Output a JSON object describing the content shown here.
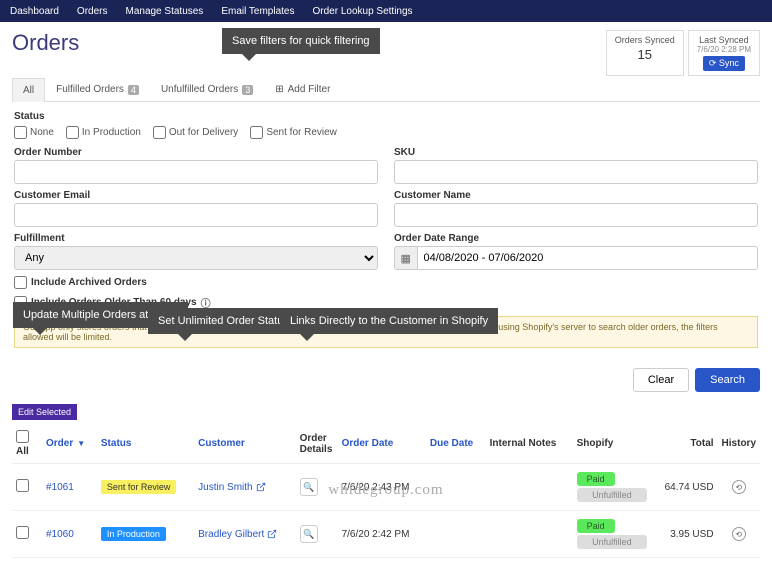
{
  "nav": [
    "Dashboard",
    "Orders",
    "Manage Statuses",
    "Email Templates",
    "Order Lookup Settings"
  ],
  "title": "Orders",
  "sync": {
    "orders_label": "Orders Synced",
    "orders_count": "15",
    "last_label": "Last Synced",
    "last_time": "7/6/20 2:28 PM",
    "btn": "⟳ Sync"
  },
  "tabs": {
    "all": "All",
    "fulfilled": "Fulfilled Orders",
    "fulfilled_badge": "4",
    "unfulfilled": "Unfulfilled Orders",
    "unfulfilled_badge": "3",
    "add": "Add Filter"
  },
  "filters": {
    "status_label": "Status",
    "statuses": [
      "None",
      "In Production",
      "Out for Delivery",
      "Sent for Review"
    ],
    "order_number": "Order Number",
    "sku": "SKU",
    "cust_email": "Customer Email",
    "cust_name": "Customer Name",
    "fulfillment": "Fulfillment",
    "fulfillment_val": "Any",
    "date_range": "Order Date Range",
    "date_val": "04/08/2020 - 07/06/2020",
    "archived": "Include Archived Orders",
    "older": "Include Orders Older Than 60 days",
    "info": "Our app only stores orders that were created within the last 60 days. To search older orders, check this. Because we're using Shopify's server to search older orders, the filters allowed will be limited."
  },
  "buttons": {
    "clear": "Clear",
    "search": "Search",
    "edit": "Edit Selected"
  },
  "cols": {
    "all": "All",
    "order": "Order",
    "status": "Status",
    "customer": "Customer",
    "details": "Order Details",
    "date": "Order Date",
    "due": "Due Date",
    "notes": "Internal Notes",
    "shopify": "Shopify",
    "total": "Total",
    "history": "History"
  },
  "rows": [
    {
      "order": "#1061",
      "status": "Sent for Review",
      "status_class": "status-review",
      "customer": "Justin Smith",
      "date": "7/6/20 2:43 PM",
      "shop_paid": "Paid",
      "shop_fulfill": "Unfulfilled",
      "total": "64.74 USD"
    },
    {
      "order": "#1060",
      "status": "In Production",
      "status_class": "status-prod",
      "customer": "Bradley Gilbert",
      "date": "7/6/20 2:42 PM",
      "shop_paid": "Paid",
      "shop_fulfill": "Unfulfilled",
      "total": "3.95 USD"
    }
  ],
  "callouts": {
    "save_filters": "Save filters for\nquick filtering",
    "multi": "Update Multiple\nOrders at Once",
    "unlimited": "Set Unlimited\nOrder Statuses",
    "links": "Links Directly to the\nCustomer in Shopify"
  },
  "watermark": "whidegroup.com"
}
